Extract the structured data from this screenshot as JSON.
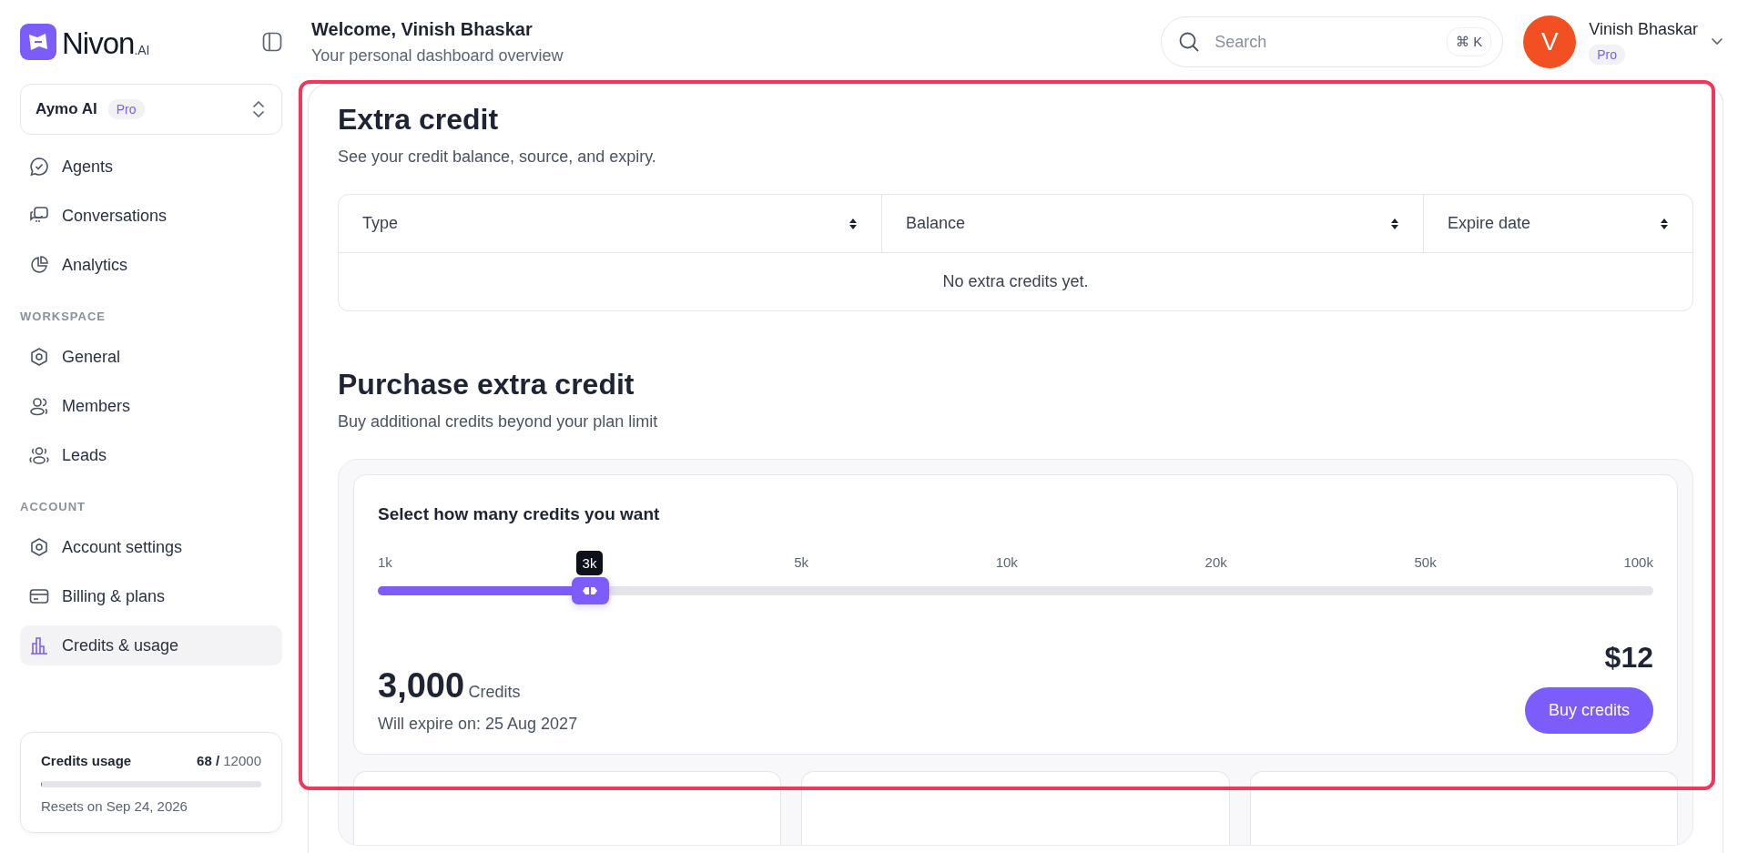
{
  "brand": {
    "name": "Nivon",
    "suffix": ".AI"
  },
  "workspace_switcher": {
    "name": "Aymo AI",
    "badge": "Pro"
  },
  "nav_groups": [
    {
      "items": [
        {
          "label": "Agents",
          "selected": false
        },
        {
          "label": "Conversations",
          "selected": false
        },
        {
          "label": "Analytics",
          "selected": false
        }
      ]
    },
    {
      "heading": "WORKSPACE",
      "items": [
        {
          "label": "General",
          "selected": false
        },
        {
          "label": "Members",
          "selected": false
        },
        {
          "label": "Leads",
          "selected": false
        }
      ]
    },
    {
      "heading": "ACCOUNT",
      "items": [
        {
          "label": "Account settings",
          "selected": false
        },
        {
          "label": "Billing & plans",
          "selected": false
        },
        {
          "label": "Credits & usage",
          "selected": true
        }
      ]
    }
  ],
  "usage": {
    "title": "Credits usage",
    "used": "68 /",
    "limit": "12000",
    "level": 0.006,
    "note": "Resets on Sep 24, 2026"
  },
  "header": {
    "title": "Welcome, Vinish Bhaskar",
    "subtitle": "Your personal dashboard overview"
  },
  "search": {
    "placeholder": "Search",
    "shortcut": "⌘ K"
  },
  "user": {
    "initial": "V",
    "name": "Vinish Bhaskar",
    "badge": "Pro"
  },
  "extra_credit": {
    "title": "Extra credit",
    "subtitle": "See your credit balance, source, and expiry.",
    "table": {
      "columns": [
        "Type",
        "Balance",
        "Expire date"
      ],
      "empty_message": "No extra credits yet."
    }
  },
  "purchase": {
    "title": "Purchase extra credit",
    "subtitle": "Buy additional credits beyond your plan limit",
    "slider": {
      "label": "Select how many credits you want",
      "ticks": [
        "1k",
        "5k",
        "10k",
        "20k",
        "50k",
        "100k"
      ],
      "tooltip": "3k",
      "level": 0.166
    },
    "amount": "3,000",
    "unit": "Credits",
    "expiry": "Will expire on: 25 Aug 2027",
    "price": "$12",
    "button": "Buy credits"
  }
}
